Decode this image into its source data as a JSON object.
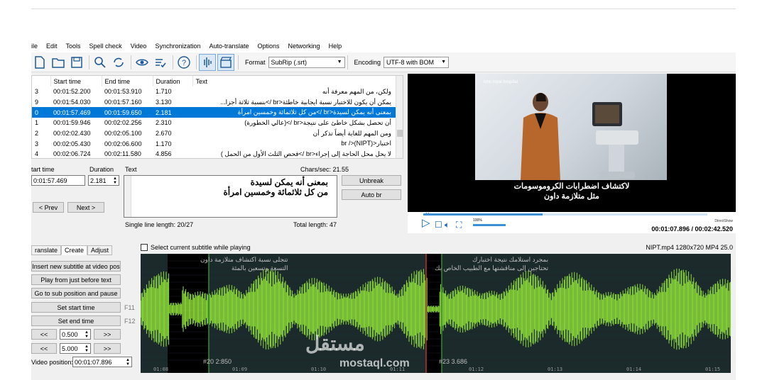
{
  "menu": [
    "ile",
    "Edit",
    "Tools",
    "Spell check",
    "Video",
    "Synchronization",
    "Auto-translate",
    "Options",
    "Networking",
    "Help"
  ],
  "toolbar": {
    "format_label": "Format",
    "format_value": "SubRip (.srt)",
    "encoding_label": "Encoding",
    "encoding_value": "UTF-8 with BOM"
  },
  "grid": {
    "columns": [
      "Start time",
      "End time",
      "Duration",
      "Text"
    ],
    "rows": [
      {
        "num": "3",
        "start": "00:01:52.200",
        "end": "00:01:53.910",
        "dur": "1.710",
        "text": "ولكن، من المهم معرفة أنه"
      },
      {
        "num": "9",
        "start": "00:01:54.030",
        "end": "00:01:57.160",
        "dur": "3.130",
        "text": "يمكن أن يكون للاختبار نسبة ايجابية خاطئة<br />بنسبة ثلاثة أجزا..."
      },
      {
        "num": "0",
        "start": "00:01:57.469",
        "end": "00:01:59.650",
        "dur": "2.181",
        "text": "بمعنى أنه يمكن لسيدة<br />من كل ثلاثمائة وخمسين امرأة",
        "selected": true
      },
      {
        "num": "1",
        "start": "00:01:59.946",
        "end": "00:02:02.256",
        "dur": "2.310",
        "text": "أن تحصل بشكل خاطئ على نتيجة<br />(عالي الخطورة)"
      },
      {
        "num": "2",
        "start": "00:02:02.430",
        "end": "00:02:05.100",
        "dur": "2.670",
        "text": "ومن المهم للغاية أيضاً تذكر أن"
      },
      {
        "num": "3",
        "start": "00:02:05.430",
        "end": "00:02:06.600",
        "dur": "1.170",
        "text": "اختبار<br />(NIPT)"
      },
      {
        "num": "4",
        "start": "00:02:06.724",
        "end": "00:02:11.580",
        "dur": "4.856",
        "text": "لا يحل محل الحاجة إلى إجراء<br />فحص الثلث الأول من الحمل )"
      }
    ]
  },
  "edit": {
    "start_label": "tart time",
    "start_value": "0:01:57.469",
    "duration_label": "Duration",
    "duration_value": "2.181",
    "text_label": "Text",
    "chars_sec": "Chars/sec: 21.55",
    "line1": "بمعنى أنه يمكن لسيدة",
    "line2": "من كل ثلاثمائة وخمسين امرأة",
    "prev": "< Prev",
    "next": "Next >",
    "unbreak": "Unbreak",
    "autobr": "Auto br",
    "single_line": "Single line length: 20/27",
    "total_length": "Total length: 47"
  },
  "video": {
    "logo_text": "kmc royal hospital",
    "caption1": "لاكتشاف اضطرابات الكروموسومات",
    "caption2": "مثل متلازمة داون",
    "directshow": "DirectShow",
    "timecode": "00:01:07.896 / 00:02:42.520",
    "volume_pct": "100%",
    "progress_fraction": 0.42,
    "volume_fraction": 1.0,
    "file_info": "NIPT.mp4 1280x720 MP4 25.0"
  },
  "tabs": [
    "ranslate",
    "Create",
    "Adjust"
  ],
  "create": {
    "insert": "Insert new subtitle at video pos",
    "play_before": "Play from just before text",
    "goto_sub": "Go to sub position and pause",
    "set_start": "Set start time",
    "set_end": "Set end time",
    "f11": "F11",
    "f12": "F12",
    "left_arrows": "<<",
    "right_arrows": ">>",
    "step1": "0.500",
    "step2": "5.000",
    "video_position_label": "Video position:",
    "video_position_value": "00:01:07.896"
  },
  "waveform": {
    "select_label": "Select current subtitle while playing",
    "overlay1_line1": "تتجلى نسبة اكتشاف متلازمة داون",
    "overlay1_line2": "التسعة وتسعين بالمئة",
    "overlay2_line1": "بمجرد استلامك نتيجة اختبارك",
    "overlay2_line2": "تحتاجين إلى مناقشتها مع الطبيب الخاص بك",
    "marker1": "#20 2:850",
    "marker2": "#23  3.686",
    "ticks": [
      "01:08",
      "01:09",
      "01:10",
      "01:11",
      "01:12",
      "01:13",
      "01:14",
      "01:15"
    ]
  },
  "watermark": {
    "arabic": "مستقل",
    "latin": "mostaql.com"
  },
  "colors": {
    "selection": "#0078d7",
    "wave": "#8fe03a",
    "accent": "#1565c0"
  }
}
